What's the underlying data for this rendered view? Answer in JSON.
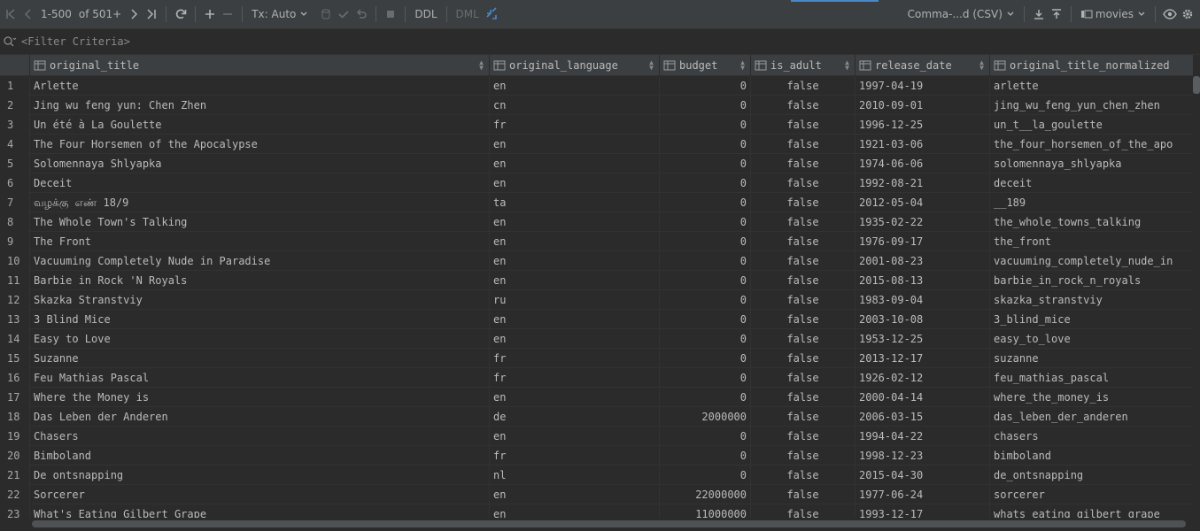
{
  "toolbar": {
    "range": "1-500",
    "of_count": "of 501+",
    "tx_mode": "Tx: Auto",
    "ddl_label": "DDL",
    "dml_label": "DML",
    "export_format": "Comma-...d (CSV)",
    "table_name": "movies",
    "icons": [
      "first-page-icon",
      "prev-page-icon",
      "next-page-icon",
      "last-page-icon",
      "refresh-icon",
      "add-row-icon",
      "delete-row-icon",
      "dropdown-icon",
      "db-icon",
      "commit-icon",
      "rollback-icon",
      "stop-icon",
      "compare-icon",
      "download-icon",
      "upload-icon",
      "table-icon",
      "eye-icon",
      "gear-icon"
    ]
  },
  "filter": {
    "placeholder": "<Filter Criteria>"
  },
  "columns": [
    "original_title",
    "original_language",
    "budget",
    "is_adult",
    "release_date",
    "original_title_normalized"
  ],
  "rows": [
    [
      "1",
      "Arlette",
      "en",
      "0",
      "false",
      "1997-04-19",
      "arlette"
    ],
    [
      "2",
      "Jing wu feng yun: Chen Zhen",
      "cn",
      "0",
      "false",
      "2010-09-01",
      "jing_wu_feng_yun_chen_zhen"
    ],
    [
      "3",
      "Un été à La Goulette",
      "fr",
      "0",
      "false",
      "1996-12-25",
      "un_t__la_goulette"
    ],
    [
      "4",
      "The Four Horsemen of the Apocalypse",
      "en",
      "0",
      "false",
      "1921-03-06",
      "the_four_horsemen_of_the_apo"
    ],
    [
      "5",
      "Solomennaya Shlyapka",
      "en",
      "0",
      "false",
      "1974-06-06",
      "solomennaya_shlyapka"
    ],
    [
      "6",
      "Deceit",
      "en",
      "0",
      "false",
      "1992-08-21",
      "deceit"
    ],
    [
      "7",
      "வழக்கு எண் 18/9",
      "ta",
      "0",
      "false",
      "2012-05-04",
      "__189"
    ],
    [
      "8",
      "The Whole Town's Talking",
      "en",
      "0",
      "false",
      "1935-02-22",
      "the_whole_towns_talking"
    ],
    [
      "9",
      "The Front",
      "en",
      "0",
      "false",
      "1976-09-17",
      "the_front"
    ],
    [
      "10",
      "Vacuuming Completely Nude in Paradise",
      "en",
      "0",
      "false",
      "2001-08-23",
      "vacuuming_completely_nude_in"
    ],
    [
      "11",
      "Barbie in Rock 'N Royals",
      "en",
      "0",
      "false",
      "2015-08-13",
      "barbie_in_rock_n_royals"
    ],
    [
      "12",
      "Skazka Stranstviy",
      "ru",
      "0",
      "false",
      "1983-09-04",
      "skazka_stranstviy"
    ],
    [
      "13",
      "3 Blind Mice",
      "en",
      "0",
      "false",
      "2003-10-08",
      "3_blind_mice"
    ],
    [
      "14",
      "Easy to Love",
      "en",
      "0",
      "false",
      "1953-12-25",
      "easy_to_love"
    ],
    [
      "15",
      "Suzanne",
      "fr",
      "0",
      "false",
      "2013-12-17",
      "suzanne"
    ],
    [
      "16",
      "Feu Mathias Pascal",
      "fr",
      "0",
      "false",
      "1926-02-12",
      "feu_mathias_pascal"
    ],
    [
      "17",
      "Where the Money is",
      "en",
      "0",
      "false",
      "2000-04-14",
      "where_the_money_is"
    ],
    [
      "18",
      "Das Leben der Anderen",
      "de",
      "2000000",
      "false",
      "2006-03-15",
      "das_leben_der_anderen"
    ],
    [
      "19",
      "Chasers",
      "en",
      "0",
      "false",
      "1994-04-22",
      "chasers"
    ],
    [
      "20",
      "Bimboland",
      "fr",
      "0",
      "false",
      "1998-12-23",
      "bimboland"
    ],
    [
      "21",
      "De ontsnapping",
      "nl",
      "0",
      "false",
      "2015-04-30",
      "de_ontsnapping"
    ],
    [
      "22",
      "Sorcerer",
      "en",
      "22000000",
      "false",
      "1977-06-24",
      "sorcerer"
    ],
    [
      "23",
      "What's Eating Gilbert Grape",
      "en",
      "11000000",
      "false",
      "1993-12-17",
      "whats_eating_gilbert_grape"
    ]
  ],
  "colors": {
    "background": "#2b2b2b",
    "toolbar": "#3c3f41",
    "text": "#bbbbbb",
    "accent": "#4a88c7"
  }
}
